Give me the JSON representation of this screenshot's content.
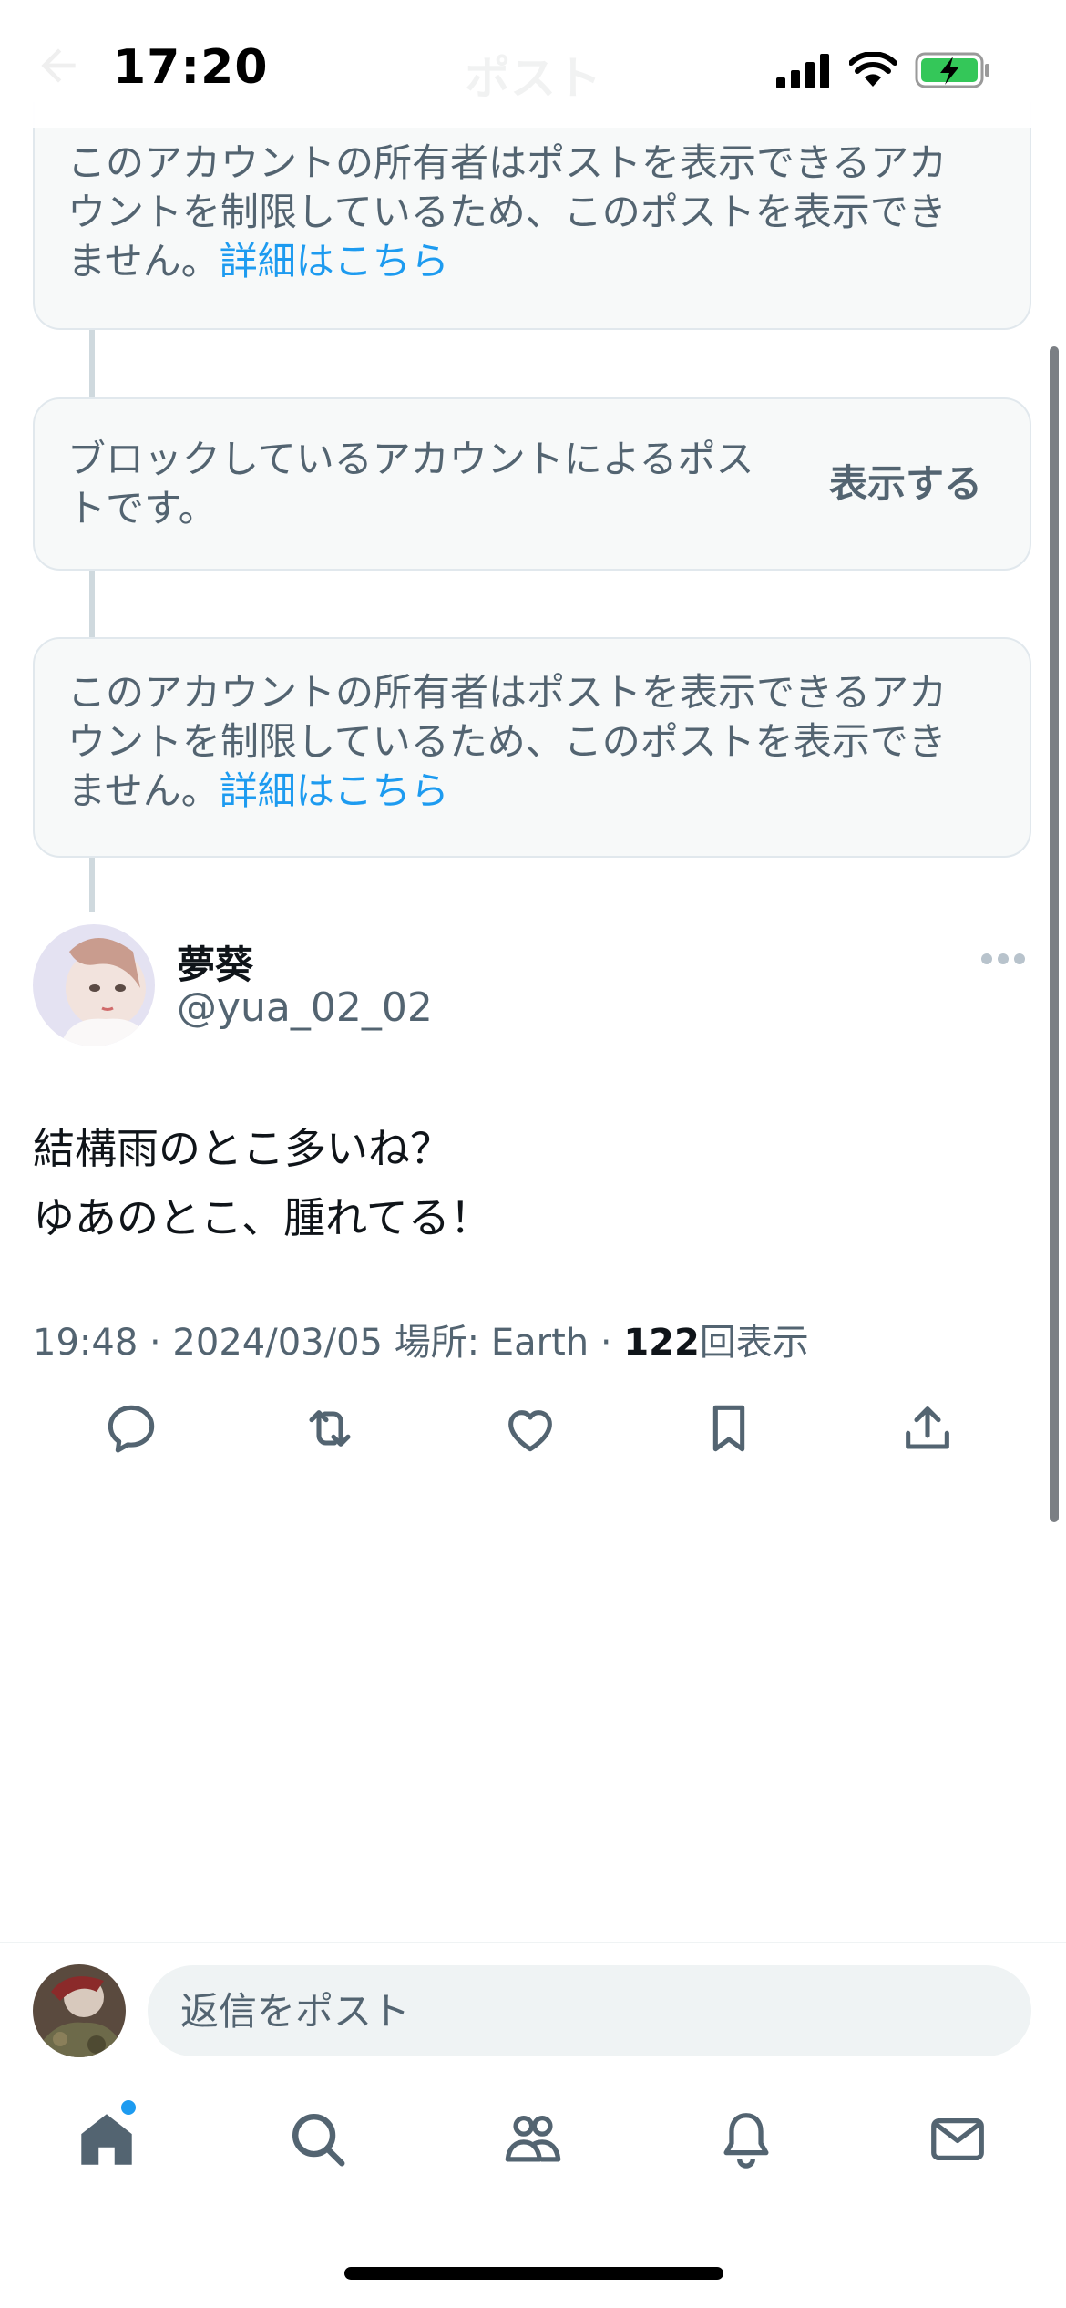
{
  "status_bar": {
    "time": "17:20"
  },
  "header": {
    "title": "ポスト"
  },
  "thread": {
    "notices": [
      {
        "text": "このアカウントの所有者はポストを表示できるアカウントを制限しているため、このポストを表示できません。",
        "link": "詳細はこちら"
      },
      {
        "text": "ブロックしているアカウントによるポストです。",
        "action": "表示する"
      },
      {
        "text": "このアカウントの所有者はポストを表示できるアカウントを制限しているため、このポストを表示できません。",
        "link": "詳細はこちら"
      }
    ]
  },
  "post": {
    "author_name": "夢葵",
    "author_handle": "@yua_02_02",
    "text_lines": [
      "結構雨のとこ多いね？",
      "ゆあのとこ、腫れてる！"
    ],
    "meta_time_date": "19:48 · 2024/03/05",
    "meta_location": "場所: Earth",
    "meta_sep": "·",
    "views_count": "122",
    "views_label": "回表示"
  },
  "reply": {
    "placeholder": "返信をポスト"
  },
  "colors": {
    "accent": "#1d9bf0",
    "secondary_text": "#536471",
    "primary_text": "#0f1419",
    "card_bg": "#f7f9f9",
    "battery_green": "#34c759"
  },
  "icons": {
    "actions": [
      "reply-icon",
      "repost-icon",
      "like-icon",
      "bookmark-icon",
      "share-icon"
    ],
    "tabs": [
      "home-icon",
      "search-icon",
      "communities-icon",
      "notifications-icon",
      "messages-icon"
    ]
  }
}
